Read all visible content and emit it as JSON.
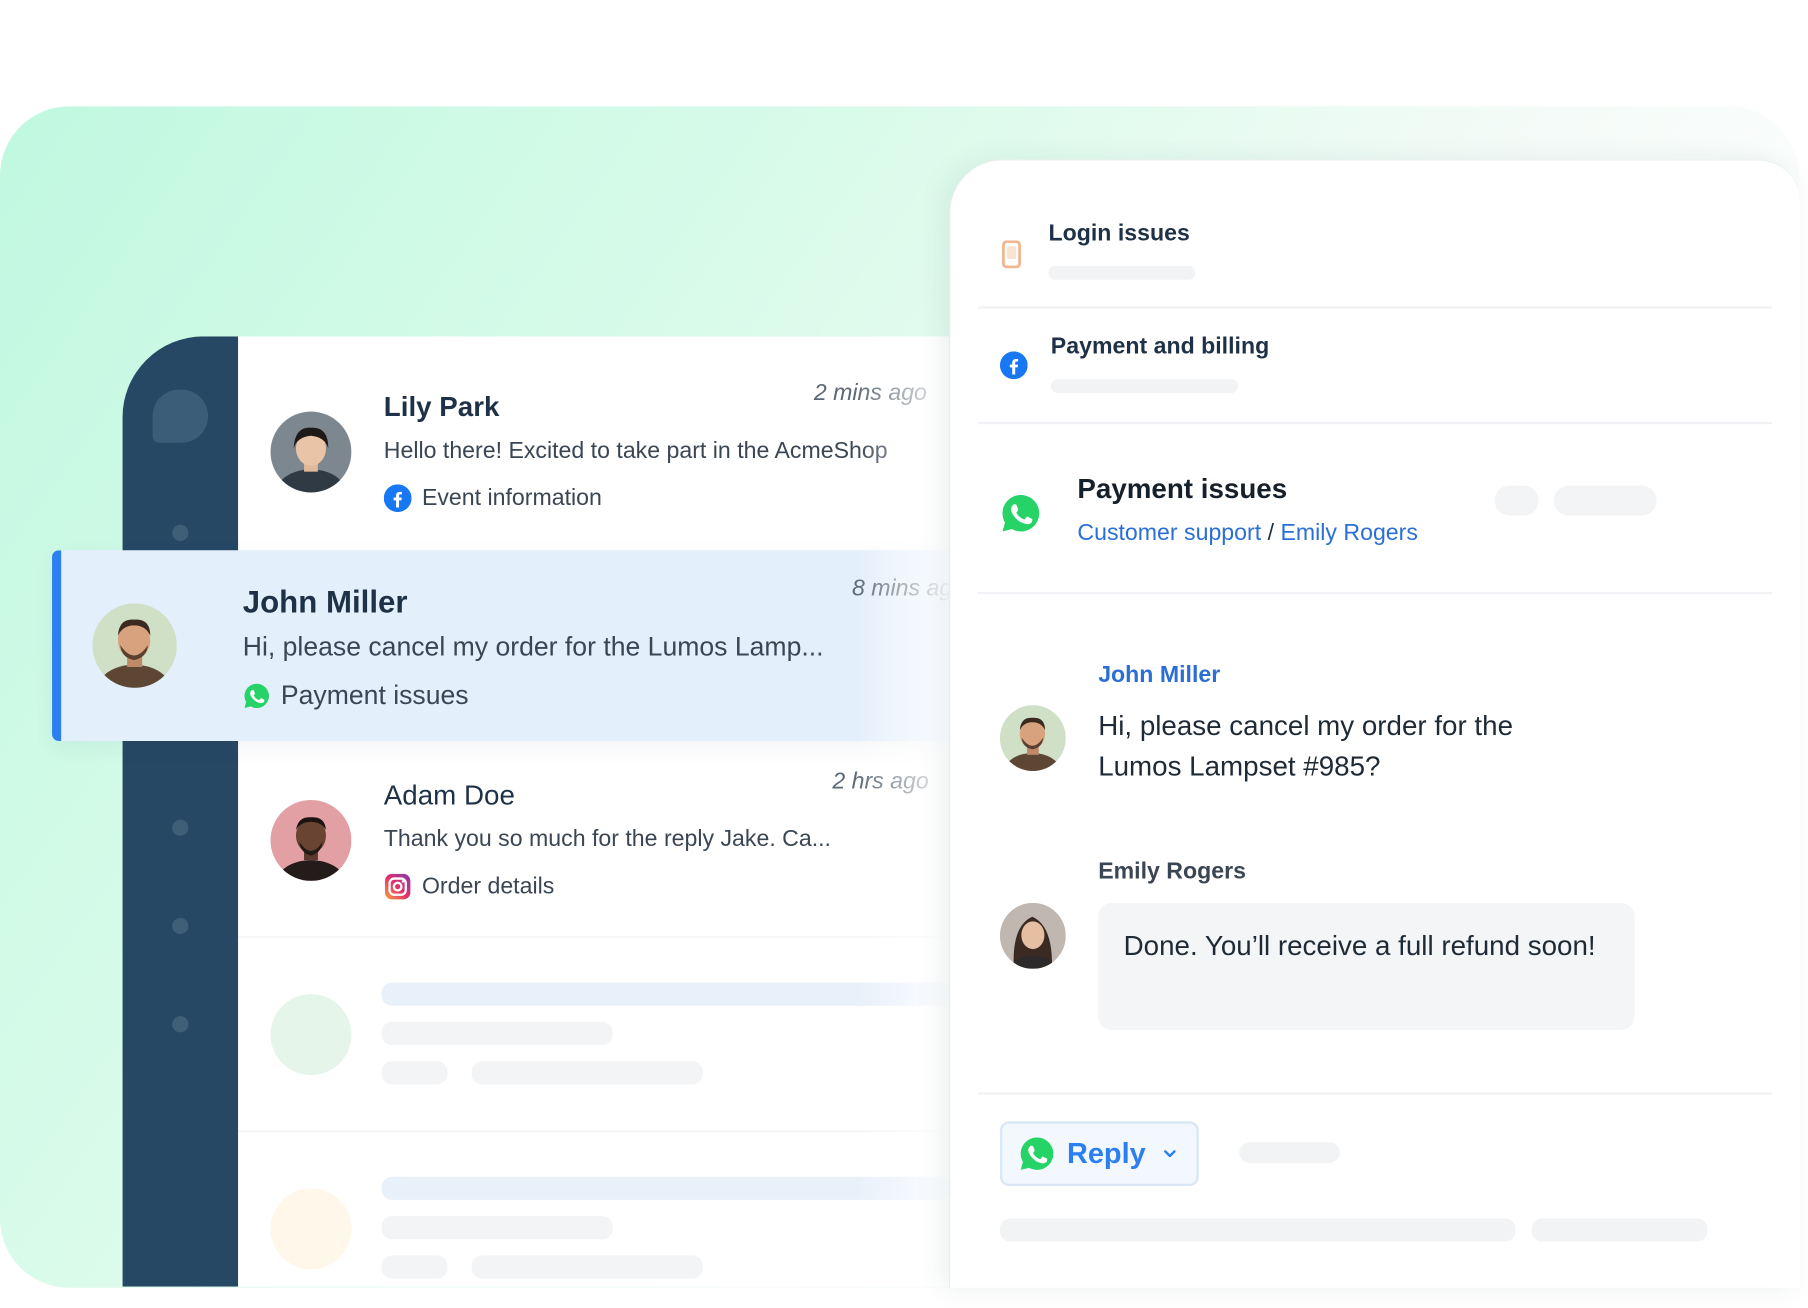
{
  "conversations": [
    {
      "name": "Lily Park",
      "time": "2 mins ago",
      "preview": "Hello there! Excited to take part in the AcmeShop",
      "channel_icon": "facebook-icon",
      "tag": "Event information"
    },
    {
      "name": "John Miller",
      "time": "8 mins ago",
      "preview": "Hi, please cancel my order for the Lumos Lamp...",
      "channel_icon": "whatsapp-icon",
      "tag": "Payment issues",
      "selected": true
    },
    {
      "name": "Adam Doe",
      "time": "2 hrs ago",
      "preview": "Thank you so much for the reply Jake. Ca...",
      "channel_icon": "instagram-icon",
      "tag": "Order details"
    }
  ],
  "detail": {
    "topics": [
      {
        "icon": "mobile-icon",
        "title": "Login issues"
      },
      {
        "icon": "facebook-icon",
        "title": "Payment and billing"
      }
    ],
    "active": {
      "icon": "whatsapp-icon",
      "title": "Payment issues",
      "team": "Customer support",
      "separator": "/",
      "agent": "Emily Rogers"
    },
    "messages": [
      {
        "author": "John Miller",
        "text": "Hi, please cancel my order for the Lumos Lampset #985?"
      },
      {
        "author": "Emily Rogers",
        "text": "Done. You’ll receive a full refund soon!"
      }
    ],
    "reply": {
      "label": "Reply",
      "icon": "whatsapp-icon"
    }
  },
  "colors": {
    "accent": "#2b7ff0",
    "rail": "#274864",
    "whatsapp": "#25d366",
    "facebook": "#1877f2",
    "background_mint": "#c0f8e0"
  }
}
